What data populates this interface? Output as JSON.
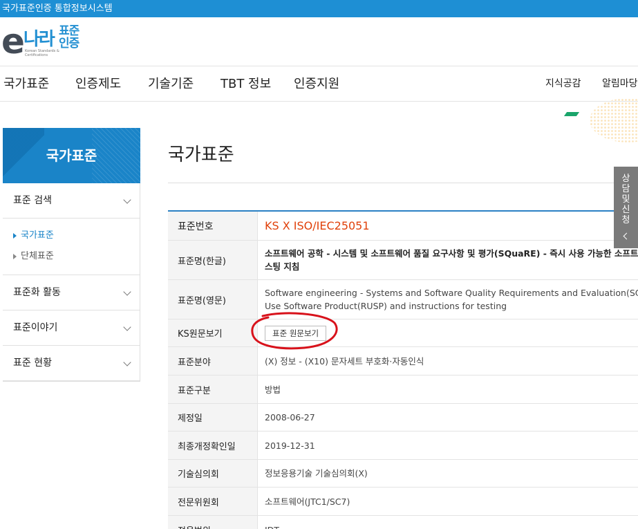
{
  "window": {
    "title": "국가표준인증 통합정보시스템"
  },
  "logo": {
    "e": "e",
    "nara": "나라",
    "brand": "표준인증",
    "tagline": "Korean Standards & Certifications"
  },
  "gnb": {
    "items": [
      "국가표준",
      "인증제도",
      "기술기준",
      "TBT 정보",
      "인증지원"
    ],
    "util": [
      "지식공감",
      "알림마당"
    ]
  },
  "lnb": {
    "title": "국가표준",
    "search": "표준 검색",
    "sub_items": [
      "국가표준",
      "단체표준"
    ],
    "menus": [
      "표준화 활동",
      "표준이야기",
      "표준 현황"
    ]
  },
  "content": {
    "page_title": "국가표준",
    "rows": [
      {
        "label": "표준번호",
        "value": "KS X ISO/IEC25051"
      },
      {
        "label": "표준명(한글)",
        "lines": [
          "소프트웨어 공학 - 시스템 및 소프트웨어 품질 요구사항 및 평가(SQuaRE) - 즉시 사용 가능한 소프트웨어 제품(RUSP)에 대한 품질 요구사항 및 테",
          "스팅 지침"
        ]
      },
      {
        "label": "표준명(영문)",
        "lines": [
          "Software engineering - Systems and Software Quality Requirements and Evaluation(SQuaRE) - Requirements for quality of Ready to",
          "Use Software Product(RUSP) and instructions for testing"
        ]
      },
      {
        "label": "KS원문보기",
        "button": "표준 원문보기"
      },
      {
        "label": "표준분야",
        "value": "(X) 정보 - (X10) 문자세트 부호화·자동인식"
      },
      {
        "label": "표준구분",
        "value": "방법"
      },
      {
        "label": "제정일",
        "value": "2008-06-27"
      },
      {
        "label": "최종개정확인일",
        "value": "2019-12-31"
      },
      {
        "label": "기술심의회",
        "value": "정보응용기술 기술심의회(X)"
      },
      {
        "label": "전문위원회",
        "value": "소프트웨어(JTC1/SC7)"
      },
      {
        "label": "적용범위",
        "value": "IDT"
      }
    ]
  },
  "side_tab": {
    "label": "상담및신청"
  },
  "colors": {
    "titlebar": "#1e8fd4",
    "lnb_head": "#1a84c8",
    "code": "#e0400a",
    "annotation": "#d8121b"
  }
}
